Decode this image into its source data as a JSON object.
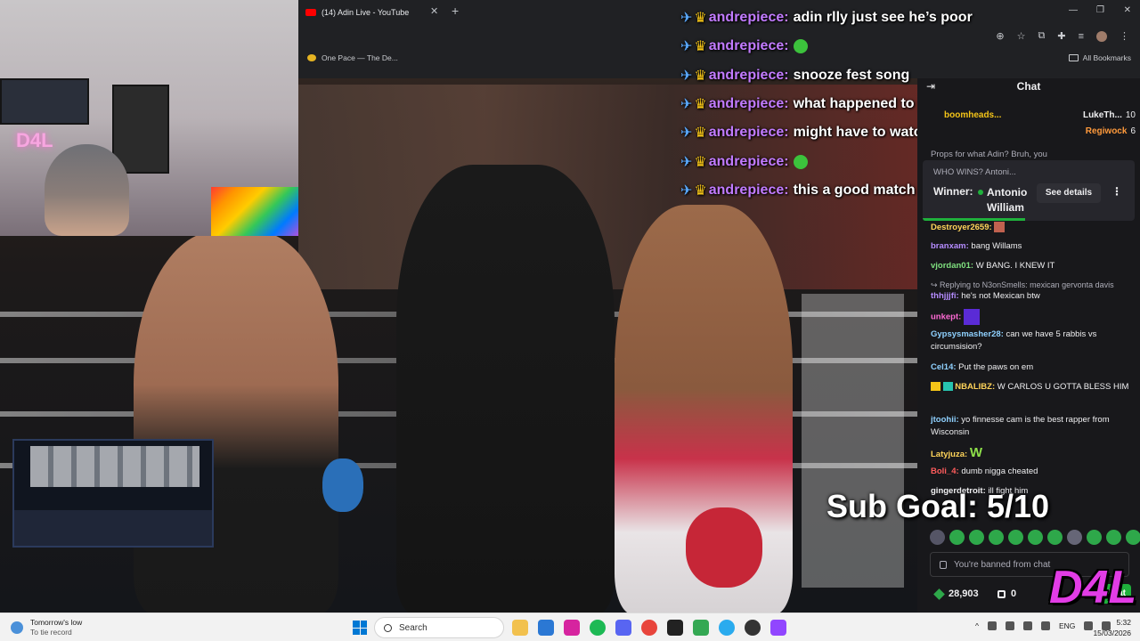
{
  "browser": {
    "tab_title": "(14) Adin Live - YouTube",
    "tab_close": "✕",
    "new_tab": "+",
    "bookmark": "One Pace — The De...",
    "all_bookmarks": "All Bookmarks"
  },
  "overlay_chat": [
    {
      "user": "andrepiece:",
      "text": "adin rlly just see he’s poor"
    },
    {
      "user": "andrepiece:",
      "text": "",
      "emote": true
    },
    {
      "user": "andrepiece:",
      "text": "snooze fest song"
    },
    {
      "user": "andrepiece:",
      "text": "what happened to polo g"
    },
    {
      "user": "andrepiece:",
      "text": "might have to watch that stream"
    },
    {
      "user": "andrepiece:",
      "text": "",
      "emote": true
    },
    {
      "user": "andrepiece:",
      "text": "this a good match lowk"
    }
  ],
  "chat": {
    "header": "Chat",
    "gifters": [
      {
        "name": "boomheads...",
        "count": ""
      },
      {
        "name": "LukeTh...",
        "count": "10"
      },
      {
        "name": "Regiwock",
        "count": "6"
      }
    ],
    "partial_line": "Props for what Adin? Bruh, you",
    "prediction": {
      "question": "WHO WINS? Antoni...",
      "winner_label": "Winner:",
      "winner_name": "Antonio William",
      "details_button": "See details"
    },
    "messages": [
      {
        "user": "Destroyer2659:",
        "text": "",
        "color": "#ffd45a"
      },
      {
        "user": "branxam:",
        "text": "bang Willams",
        "color": "#b58cff"
      },
      {
        "user": "vjordan01:",
        "text": "W BANG. I KNEW IT",
        "color": "#7fe07f"
      },
      {
        "user": "",
        "text": "Replying to N3onSmells: mexican gervonta davis",
        "color": "#adadb8",
        "reply": true
      },
      {
        "user": "thhjjjfi:",
        "text": "he's not Mexican btw",
        "color": "#b58cff"
      },
      {
        "user": "unkept:",
        "text": "",
        "color": "#ff6ad5"
      },
      {
        "user": "Gypsysmasher28:",
        "text": "can we have 5 rabbis vs circumsision?",
        "color": "#8fd1ff"
      },
      {
        "user": "Cel14:",
        "text": "Put the paws on em",
        "color": "#8fd1ff"
      },
      {
        "user": "NBALIBZ:",
        "text": "W CARLOS U GOTTA BLESS HIM",
        "color": "#ffd45a"
      },
      {
        "user": "jtoohii:",
        "text": "yo finnesse cam is the best rapper from Wisconsin",
        "color": "#8fd1ff"
      },
      {
        "user": "Latyjuza:",
        "text": "W",
        "color": "#ffd45a"
      },
      {
        "user": "Boli_4:",
        "text": "dumb nigga cheated",
        "color": "#ff5c5c"
      },
      {
        "user": "gingerdetroit:",
        "text": "ill fight him",
        "color": "#efeff1"
      }
    ],
    "input_placeholder": "You're banned from chat",
    "points": "28,903",
    "bits": "0",
    "chat_button": "Chat"
  },
  "overlays": {
    "sub_goal": "Sub Goal: 5/10",
    "logo": "D4L",
    "neon": "D4L"
  },
  "taskbar": {
    "weather_title": "Tomorrow's low",
    "weather_sub": "To tie record",
    "search": "Search",
    "lang": "ENG",
    "time": "5:32",
    "date": "15/03/2026"
  }
}
